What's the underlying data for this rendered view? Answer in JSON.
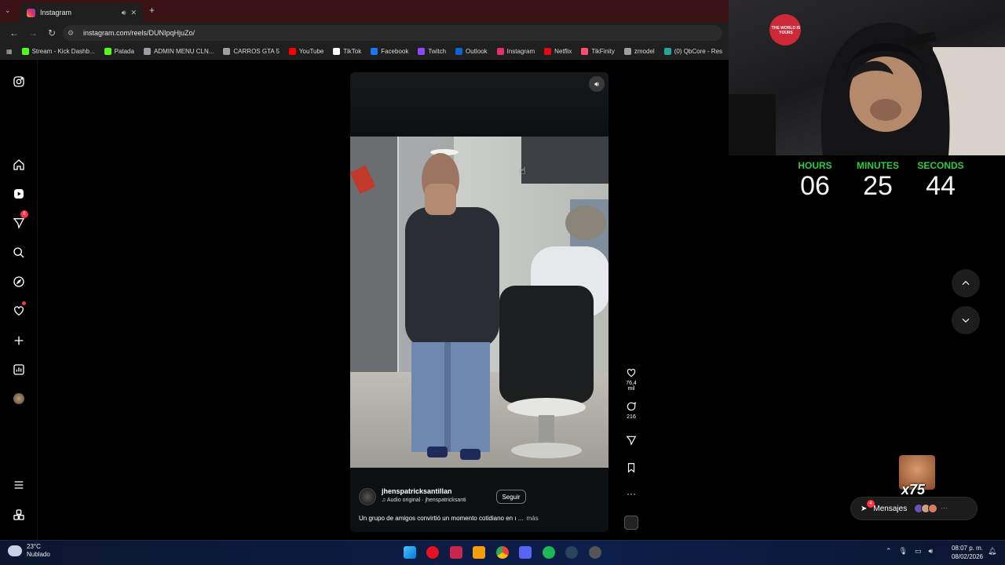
{
  "browser": {
    "tab_title": "Instagram",
    "url": "instagram.com/reels/DUNIpqHjuZo/",
    "bookmarks": [
      {
        "label": "Stream - Kick Dashb...",
        "color": "#53fc18"
      },
      {
        "label": "Patada",
        "color": "#53fc18"
      },
      {
        "label": "ADMIN MENU CLN...",
        "color": "#9aa0a6"
      },
      {
        "label": "CARROS GTA 5",
        "color": "#9aa0a6"
      },
      {
        "label": "YouTube",
        "color": "#ff0000"
      },
      {
        "label": "TikTok",
        "color": "#ffffff"
      },
      {
        "label": "Facebook",
        "color": "#1877f2"
      },
      {
        "label": "Twitch",
        "color": "#9146ff"
      },
      {
        "label": "Outlook",
        "color": "#0a64d8"
      },
      {
        "label": "Instagram",
        "color": "#e1306c"
      },
      {
        "label": "Netflix",
        "color": "#e50914"
      },
      {
        "label": "TikFinity",
        "color": "#ff4d6d"
      },
      {
        "label": "zmodel",
        "color": "#9aa0a6"
      },
      {
        "label": "(0) QbCore - Res",
        "color": "#26a69a"
      }
    ]
  },
  "nav": {
    "notifications_badge": "6"
  },
  "reel": {
    "username": "jhenspatricksantillan",
    "audio": "Audio original · jhenspatricksanti",
    "follow_label": "Seguir",
    "caption": "Un grupo de amigos convirtió un momento cotidiano en ı ...",
    "more_label": "más",
    "likes": "76,4 mil",
    "comments": "216"
  },
  "timer": {
    "hours_label": "HOURS",
    "minutes_label": "MINUTES",
    "seconds_label": "SECONDS",
    "hours": "06",
    "minutes": "25",
    "seconds": "44",
    "label_color": "#2ecc40"
  },
  "overlay": {
    "emote_multiplier": "x75",
    "cap_text": "THE WORLD IS YOURS"
  },
  "messages": {
    "label": "Mensajes",
    "badge": "4"
  },
  "taskbar": {
    "temperature": "23°C",
    "condition": "Nublado",
    "time": "08:07 p. m.",
    "date": "08/02/2026"
  }
}
